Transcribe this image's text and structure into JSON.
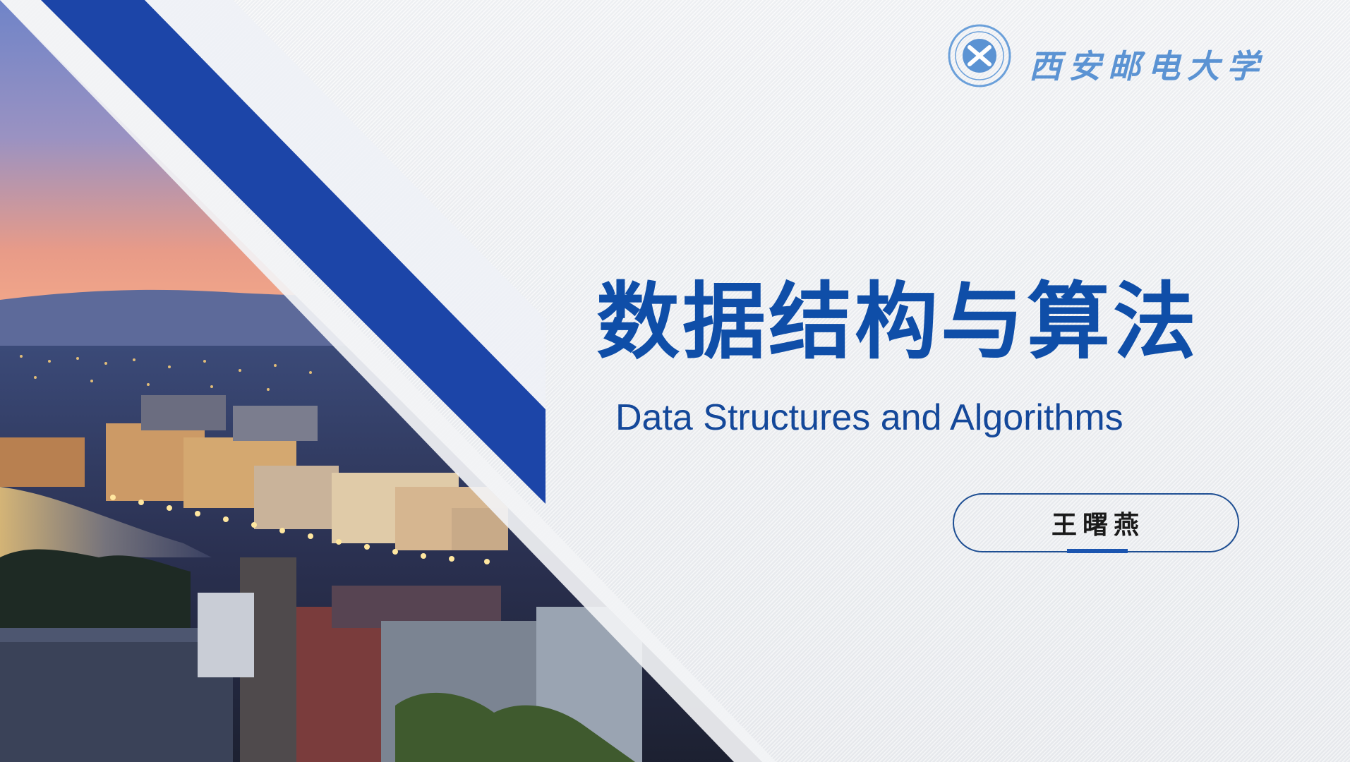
{
  "header": {
    "university_name": "西安邮电大学",
    "logo_icon": "university-seal-icon"
  },
  "title": {
    "chinese": "数据结构与算法",
    "english": "Data Structures and Algorithms"
  },
  "author": {
    "name": "王曙燕"
  },
  "colors": {
    "primary_blue": "#0f4ea8",
    "stripe_blue": "#1c45a8",
    "logo_blue": "#5b93d3"
  }
}
